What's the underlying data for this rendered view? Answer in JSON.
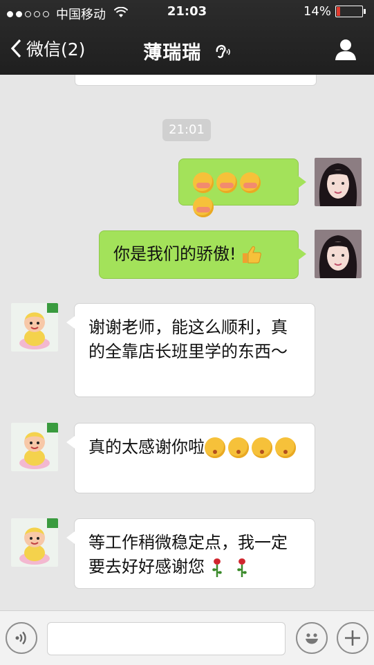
{
  "status_bar": {
    "carrier": "中国移动",
    "time": "21:03",
    "battery": "14%"
  },
  "nav": {
    "back_label": "微信(2)",
    "title": "薄瑞瑞"
  },
  "chat": {
    "timestamp": "21:01",
    "messages": [
      {
        "side": "me",
        "text": ""
      },
      {
        "side": "me",
        "text": "你是我们的骄傲!"
      },
      {
        "side": "them",
        "text": "谢谢老师，能这么顺利，真的全靠店长班里学的东西～"
      },
      {
        "side": "them",
        "text": "真的太感谢你啦"
      },
      {
        "side": "them",
        "text": "等工作稍微稳定点，我一定要去好好感谢您"
      }
    ]
  },
  "input_bar": {
    "placeholder": ""
  }
}
